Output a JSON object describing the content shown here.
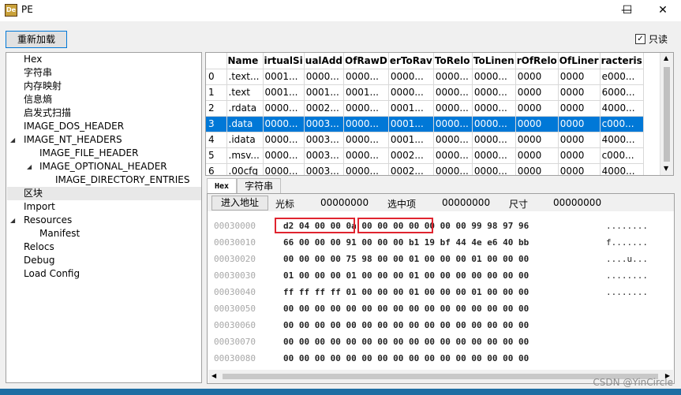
{
  "window": {
    "title": "PE",
    "icon_label": "De"
  },
  "controls": {
    "minimize": "—",
    "maximize": "☐",
    "close": "✕"
  },
  "toolbar": {
    "reload_label": "重新加载",
    "readonly_label": "只读",
    "readonly_checked": "✓"
  },
  "tree": {
    "items": [
      {
        "label": "Hex"
      },
      {
        "label": "字符串"
      },
      {
        "label": "内存映射"
      },
      {
        "label": "信息熵"
      },
      {
        "label": "启发式扫描"
      },
      {
        "label": "IMAGE_DOS_HEADER"
      },
      {
        "label": "IMAGE_NT_HEADERS"
      },
      {
        "label": "IMAGE_FILE_HEADER"
      },
      {
        "label": "IMAGE_OPTIONAL_HEADER"
      },
      {
        "label": "IMAGE_DIRECTORY_ENTRIES"
      },
      {
        "label": "区块"
      },
      {
        "label": "Import"
      },
      {
        "label": "Resources"
      },
      {
        "label": "Manifest"
      },
      {
        "label": "Relocs"
      },
      {
        "label": "Debug"
      },
      {
        "label": "Load Config"
      }
    ]
  },
  "sections_table": {
    "columns": [
      "",
      "Name",
      "irtualSi",
      "ualAdd",
      "OfRawD",
      "erToRav",
      "ToRelo",
      "ToLinen",
      "rOfRelo",
      "OfLiner",
      "racteris"
    ],
    "rows": [
      [
        "0",
        ".text...",
        "0001...",
        "0000...",
        "0000...",
        "0000...",
        "0000...",
        "0000...",
        "0000",
        "0000",
        "e000..."
      ],
      [
        "1",
        ".text",
        "0001...",
        "0001...",
        "0001...",
        "0000...",
        "0000...",
        "0000...",
        "0000",
        "0000",
        "6000..."
      ],
      [
        "2",
        ".rdata",
        "0000...",
        "0002...",
        "0000...",
        "0001...",
        "0000...",
        "0000...",
        "0000",
        "0000",
        "4000..."
      ],
      [
        "3",
        ".data",
        "0000...",
        "0003...",
        "0000...",
        "0001...",
        "0000...",
        "0000...",
        "0000",
        "0000",
        "c000..."
      ],
      [
        "4",
        ".idata",
        "0000...",
        "0003...",
        "0000...",
        "0001...",
        "0000...",
        "0000...",
        "0000",
        "0000",
        "4000..."
      ],
      [
        "5",
        ".msv...",
        "0000...",
        "0003...",
        "0000...",
        "0002...",
        "0000...",
        "0000...",
        "0000",
        "0000",
        "c000..."
      ],
      [
        "6",
        ".00cfg",
        "0000...",
        "0003...",
        "0000...",
        "0002...",
        "0000...",
        "0000...",
        "0000",
        "0000",
        "4000..."
      ]
    ],
    "selected_row": 3
  },
  "tabs": [
    {
      "label": "Hex"
    },
    {
      "label": "字符串"
    }
  ],
  "hex": {
    "goto_label": "进入地址",
    "cursor_label": "光标",
    "cursor_value": "00000000",
    "selection_label": "选中项",
    "selection_value": "00000000",
    "size_label": "尺寸",
    "size_value": "00000000",
    "rows": [
      {
        "addr": "00030000",
        "bytes": "d2 04 00 00 0a 00 00 00 00 00 00 00 99 98 97 96",
        "ascii": "........"
      },
      {
        "addr": "00030010",
        "bytes": "66 00 00 00 91 00 00 00 b1 19 bf 44 4e e6 40 bb",
        "ascii": "f......."
      },
      {
        "addr": "00030020",
        "bytes": "00 00 00 00 75 98 00 00 01 00 00 00 01 00 00 00",
        "ascii": "....u..."
      },
      {
        "addr": "00030030",
        "bytes": "01 00 00 00 01 00 00 00 01 00 00 00 00 00 00 00",
        "ascii": "........"
      },
      {
        "addr": "00030040",
        "bytes": "ff ff ff ff 01 00 00 00 01 00 00 00 01 00 00 00",
        "ascii": "........"
      },
      {
        "addr": "00030050",
        "bytes": "00 00 00 00 00 00 00 00 00 00 00 00 00 00 00 00",
        "ascii": ""
      },
      {
        "addr": "00030060",
        "bytes": "00 00 00 00 00 00 00 00 00 00 00 00 00 00 00 00",
        "ascii": ""
      },
      {
        "addr": "00030070",
        "bytes": "00 00 00 00 00 00 00 00 00 00 00 00 00 00 00 00",
        "ascii": ""
      },
      {
        "addr": "00030080",
        "bytes": "00 00 00 00 00 00 00 00 00 00 00 00 00 00 00 00",
        "ascii": ""
      }
    ]
  },
  "watermark": {
    "csdn": "CSDN @YinCircle"
  },
  "colors": {
    "selection": "#0078d7",
    "highlight_box": "#e0242f"
  }
}
